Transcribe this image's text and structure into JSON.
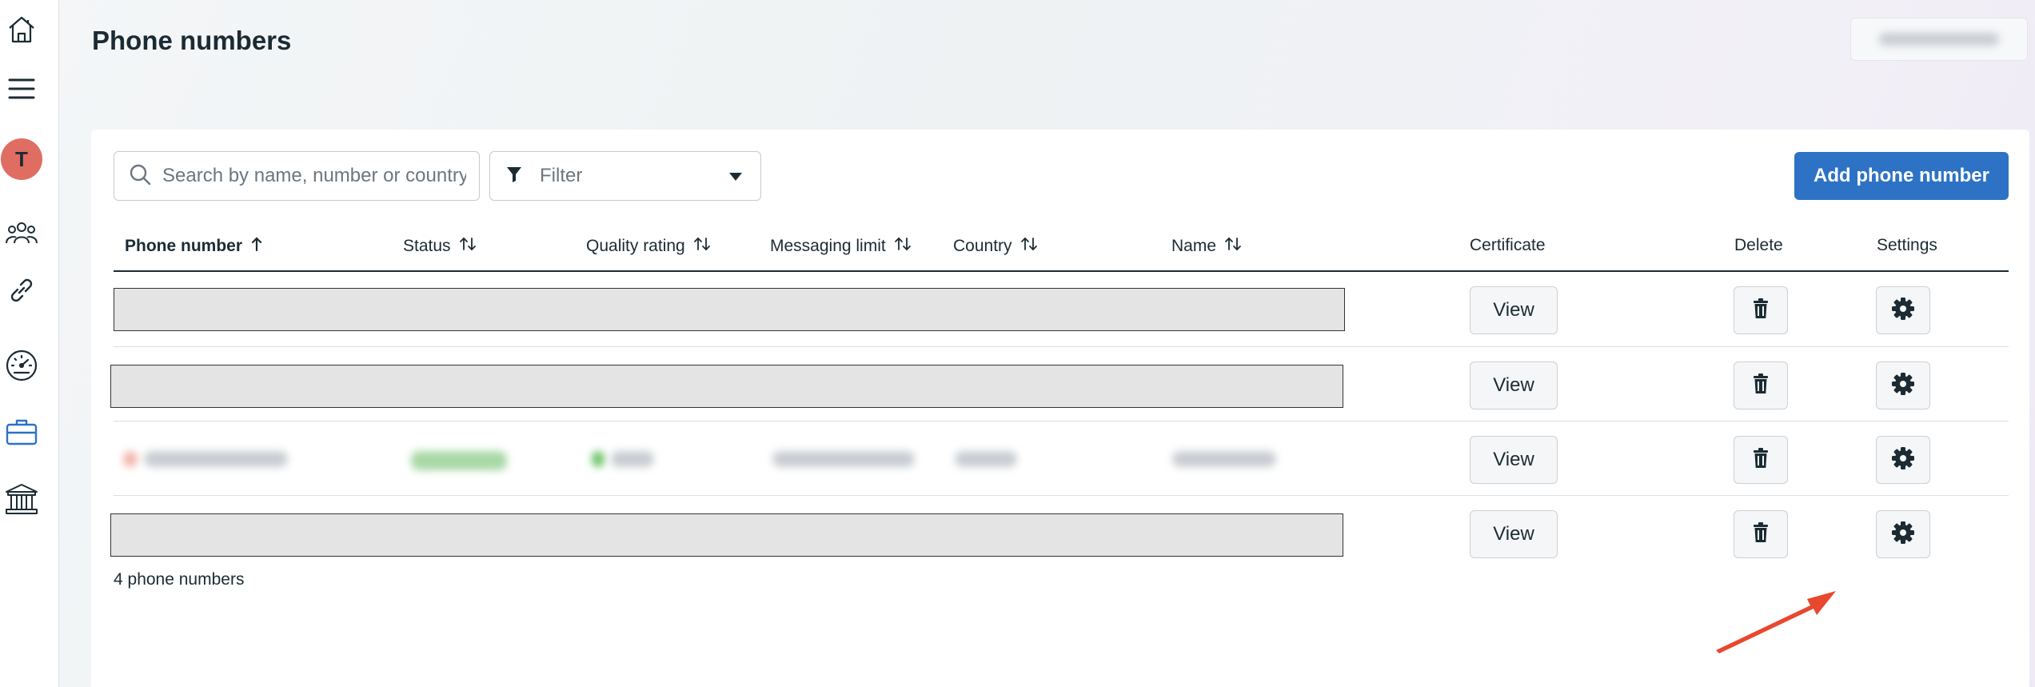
{
  "sidebar": {
    "avatar_initial": "T",
    "icons": [
      "home-icon",
      "menu-icon",
      "people-icon",
      "link-icon",
      "speedometer-icon",
      "briefcase-icon",
      "bank-icon"
    ]
  },
  "header": {
    "title": "Phone numbers"
  },
  "toolbar": {
    "search_placeholder": "Search by name, number or country",
    "filter_label": "Filter",
    "add_button_label": "Add phone number"
  },
  "table": {
    "columns": [
      {
        "label": "Phone number",
        "sort": "ascending"
      },
      {
        "label": "Status",
        "sort": "none"
      },
      {
        "label": "Quality rating",
        "sort": "none"
      },
      {
        "label": "Messaging limit",
        "sort": "none"
      },
      {
        "label": "Country",
        "sort": "none"
      },
      {
        "label": "Name",
        "sort": "none"
      },
      {
        "label": "Certificate"
      },
      {
        "label": "Delete"
      },
      {
        "label": "Settings"
      }
    ],
    "rows": [
      {
        "redacted": true,
        "certificate_label": "View"
      },
      {
        "redacted": true,
        "certificate_label": "View"
      },
      {
        "redacted": false,
        "blurred": true,
        "certificate_label": "View"
      },
      {
        "redacted": true,
        "certificate_label": "View"
      }
    ],
    "footer_count": "4 phone numbers"
  },
  "colors": {
    "primary_button": "#2d72c4",
    "avatar": "#e06d62",
    "annotation_arrow": "#e8482e"
  }
}
